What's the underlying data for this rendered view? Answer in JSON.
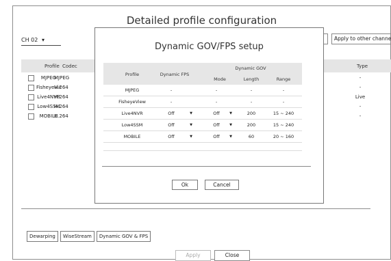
{
  "main": {
    "title": "Detailed profile configuration",
    "channel": "CH 02",
    "apply_other": "Apply to other channels",
    "columns": {
      "profile": "Profile",
      "codec": "Codec",
      "type": "Type"
    },
    "rows": [
      {
        "profile": "MJPEG",
        "codec": "MJPEG",
        "type": "-"
      },
      {
        "profile": "FisheyeVie..",
        "codec": "H.264",
        "type": "-"
      },
      {
        "profile": "Live4NVR",
        "codec": "H.264",
        "type": "Live"
      },
      {
        "profile": "Low4SSM",
        "codec": "H.264",
        "type": "-"
      },
      {
        "profile": "MOBILE",
        "codec": "H.264",
        "type": "-"
      }
    ],
    "tabs": [
      "Dewarping",
      "WiseStream",
      "Dynamic GOV & FPS"
    ],
    "apply_label": "Apply",
    "close_label": "Close"
  },
  "modal": {
    "title": "Dynamic GOV/FPS setup",
    "headers": {
      "profile": "Profile",
      "dynamic_fps": "Dynamic FPS",
      "dynamic_gov": "Dynamic GOV",
      "mode": "Mode",
      "length": "Length",
      "range": "Range"
    },
    "rows": [
      {
        "profile": "MJPEG",
        "fps": "-",
        "mode": "-",
        "length": "-",
        "range": "-"
      },
      {
        "profile": "FisheyeView",
        "fps": "-",
        "mode": "-",
        "length": "-",
        "range": "-"
      },
      {
        "profile": "Live4NVR",
        "fps": "Off",
        "mode": "Off",
        "length": "200",
        "range": "15 ~ 240"
      },
      {
        "profile": "Low4SSM",
        "fps": "Off",
        "mode": "Off",
        "length": "200",
        "range": "15 ~ 240"
      },
      {
        "profile": "MOBILE",
        "fps": "Off",
        "mode": "Off",
        "length": "60",
        "range": "20 ~ 160"
      }
    ],
    "ok_label": "Ok",
    "cancel_label": "Cancel"
  }
}
